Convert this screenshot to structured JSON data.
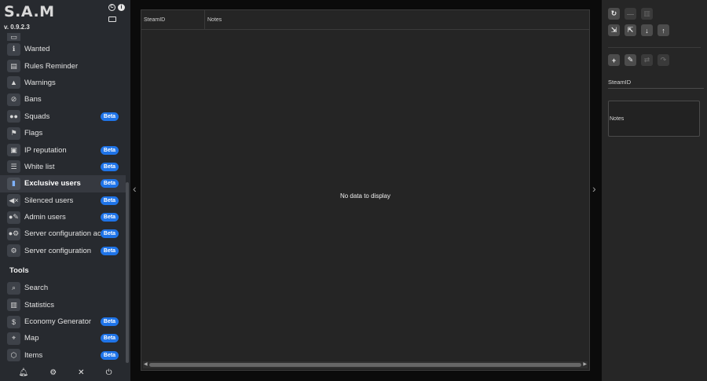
{
  "app": {
    "brand": "S.A.M",
    "version": "v. 0.9.2.3"
  },
  "nav": {
    "items": [
      {
        "label": "",
        "icon": "partial-icon",
        "badge": ""
      },
      {
        "label": "Wanted",
        "icon": "info-icon",
        "badge": ""
      },
      {
        "label": "Rules Reminder",
        "icon": "document-icon",
        "badge": ""
      },
      {
        "label": "Warnings",
        "icon": "warning-icon",
        "badge": ""
      },
      {
        "label": "Bans",
        "icon": "ban-user-icon",
        "badge": ""
      },
      {
        "label": "Squads",
        "icon": "users-icon",
        "badge": "Beta"
      },
      {
        "label": "Flags",
        "icon": "flag-icon",
        "badge": ""
      },
      {
        "label": "IP reputation",
        "icon": "id-icon",
        "badge": "Beta"
      },
      {
        "label": "White list",
        "icon": "list-icon",
        "badge": "Beta"
      },
      {
        "label": "Exclusive users",
        "icon": "clipboard-icon",
        "badge": "Beta",
        "active": true
      },
      {
        "label": "Silenced users",
        "icon": "mute-icon",
        "badge": "Beta"
      },
      {
        "label": "Admin users",
        "icon": "admin-icon",
        "badge": "Beta"
      },
      {
        "label": "Server configuration access",
        "icon": "user-gear-icon",
        "badge": "Beta"
      },
      {
        "label": "Server configuration",
        "icon": "gears-icon",
        "badge": "Beta"
      }
    ],
    "tools_title": "Tools",
    "tools": [
      {
        "label": "Search",
        "icon": "search-icon",
        "badge": ""
      },
      {
        "label": "Statistics",
        "icon": "chart-icon",
        "badge": ""
      },
      {
        "label": "Economy Generator",
        "icon": "money-hand-icon",
        "badge": "Beta"
      },
      {
        "label": "Map",
        "icon": "map-icon",
        "badge": "Beta"
      },
      {
        "label": "Items",
        "icon": "box-icon",
        "badge": "Beta"
      }
    ]
  },
  "grid": {
    "columns": [
      "SteamID",
      "Notes"
    ],
    "empty_text": "No data to display"
  },
  "editor": {
    "steamid_label": "SteamID",
    "notes_label": "Notes"
  },
  "colors": {
    "accent": "#1f74e8",
    "sidebar_bg": "#272a2f",
    "panel_bg": "#262626"
  }
}
